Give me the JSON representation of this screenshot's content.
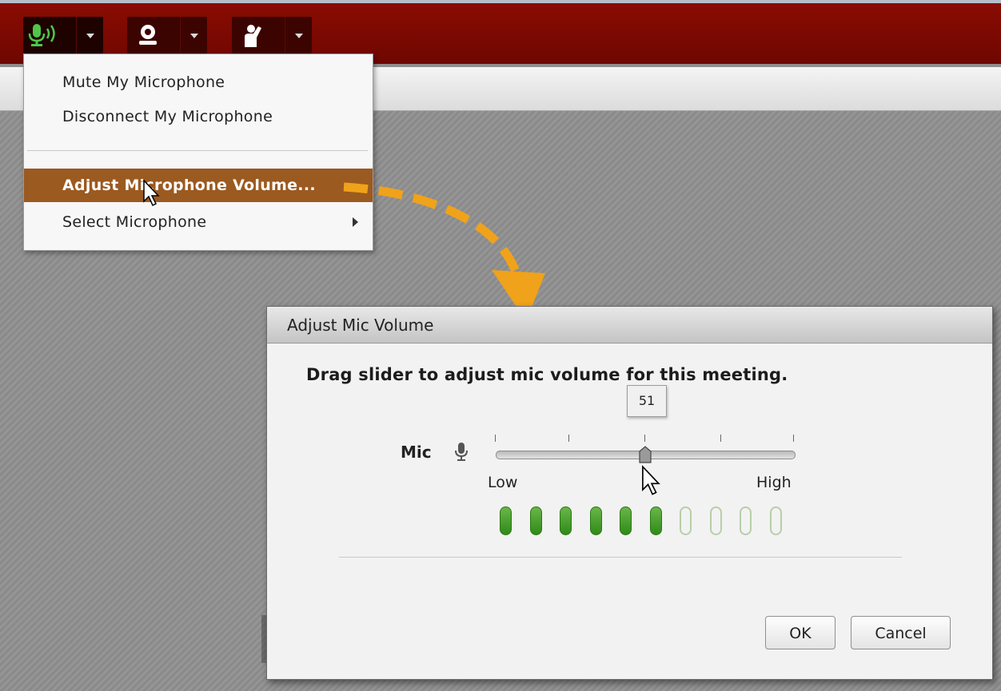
{
  "toolbar": {
    "buttons": [
      {
        "name": "microphone",
        "icon": "microphone-speaking-icon",
        "color": "#4fc64a"
      },
      {
        "name": "webcam",
        "icon": "webcam-icon",
        "color": "#ffffff"
      },
      {
        "name": "raise-hand",
        "icon": "raise-hand-icon",
        "color": "#ffffff"
      }
    ]
  },
  "menu": {
    "items": [
      {
        "label": "Mute My Microphone"
      },
      {
        "label": "Disconnect My Microphone"
      },
      {
        "label": "Adjust Microphone Volume..."
      },
      {
        "label": "Select Microphone"
      }
    ],
    "highlight_color": "#9b5a20"
  },
  "dialog": {
    "title": "Adjust Mic Volume",
    "instruction": "Drag slider to adjust mic volume for this meeting.",
    "mic_label": "Mic",
    "slider_value": "51",
    "low_label": "Low",
    "high_label": "High",
    "level_meter": {
      "lit": 6,
      "total": 10,
      "lit_color": "#3f9a24"
    },
    "ok_label": "OK",
    "cancel_label": "Cancel"
  },
  "annotation": {
    "arrow_color": "#f0a21a"
  }
}
